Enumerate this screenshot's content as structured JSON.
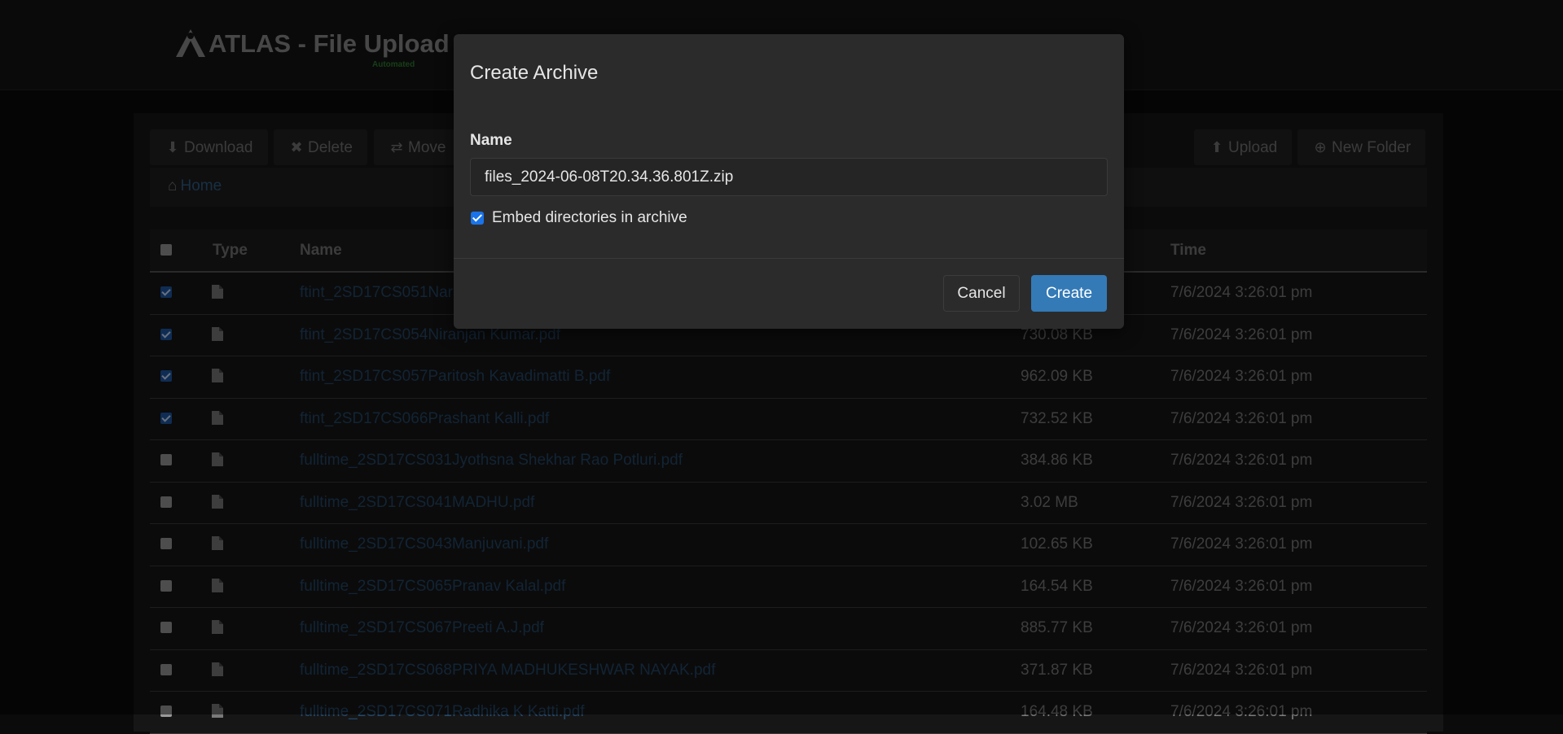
{
  "header": {
    "title": "ATLAS - File Upload Pa",
    "subtitle": "Automated"
  },
  "toolbar": {
    "download_label": "Download",
    "delete_label": "Delete",
    "move_label": "Move",
    "upload_label": "Upload",
    "new_folder_label": "New Folder"
  },
  "breadcrumb": {
    "home_label": "Home"
  },
  "table": {
    "columns": {
      "type": "Type",
      "name": "Name",
      "time": "Time"
    },
    "rows": [
      {
        "checked": true,
        "name": "ftint_2SD17CS051Nar",
        "size": "",
        "time": "7/6/2024 3:26:01 pm"
      },
      {
        "checked": true,
        "name": "ftint_2SD17CS054Niranjan Kumar.pdf",
        "size": "730.08 KB",
        "time": "7/6/2024 3:26:01 pm"
      },
      {
        "checked": true,
        "name": "ftint_2SD17CS057Paritosh Kavadimatti B.pdf",
        "size": "962.09 KB",
        "time": "7/6/2024 3:26:01 pm"
      },
      {
        "checked": true,
        "name": "ftint_2SD17CS066Prashant Kalli.pdf",
        "size": "732.52 KB",
        "time": "7/6/2024 3:26:01 pm"
      },
      {
        "checked": false,
        "name": "fulltime_2SD17CS031Jyothsna Shekhar Rao Potluri.pdf",
        "size": "384.86 KB",
        "time": "7/6/2024 3:26:01 pm"
      },
      {
        "checked": false,
        "name": "fulltime_2SD17CS041MADHU.pdf",
        "size": "3.02 MB",
        "time": "7/6/2024 3:26:01 pm"
      },
      {
        "checked": false,
        "name": "fulltime_2SD17CS043Manjuvani.pdf",
        "size": "102.65 KB",
        "time": "7/6/2024 3:26:01 pm"
      },
      {
        "checked": false,
        "name": "fulltime_2SD17CS065Pranav Kalal.pdf",
        "size": "164.54 KB",
        "time": "7/6/2024 3:26:01 pm"
      },
      {
        "checked": false,
        "name": "fulltime_2SD17CS067Preeti A.J.pdf",
        "size": "885.77 KB",
        "time": "7/6/2024 3:26:01 pm"
      },
      {
        "checked": false,
        "name": "fulltime_2SD17CS068PRIYA MADHUKESHWAR NAYAK.pdf",
        "size": "371.87 KB",
        "time": "7/6/2024 3:26:01 pm"
      },
      {
        "checked": false,
        "name": "fulltime_2SD17CS071Radhika K Katti.pdf",
        "size": "164.48 KB",
        "time": "7/6/2024 3:26:01 pm"
      }
    ]
  },
  "modal": {
    "title": "Create Archive",
    "name_label": "Name",
    "name_value": "files_2024-06-08T20.34.36.801Z.zip",
    "embed_label": "Embed directories in archive",
    "embed_checked": true,
    "cancel_label": "Cancel",
    "create_label": "Create"
  },
  "colors": {
    "accent": "#337ab7",
    "link": "#24486b",
    "brand_green": "#2f7d2f",
    "checkbox_checked": "#1a73e8"
  }
}
